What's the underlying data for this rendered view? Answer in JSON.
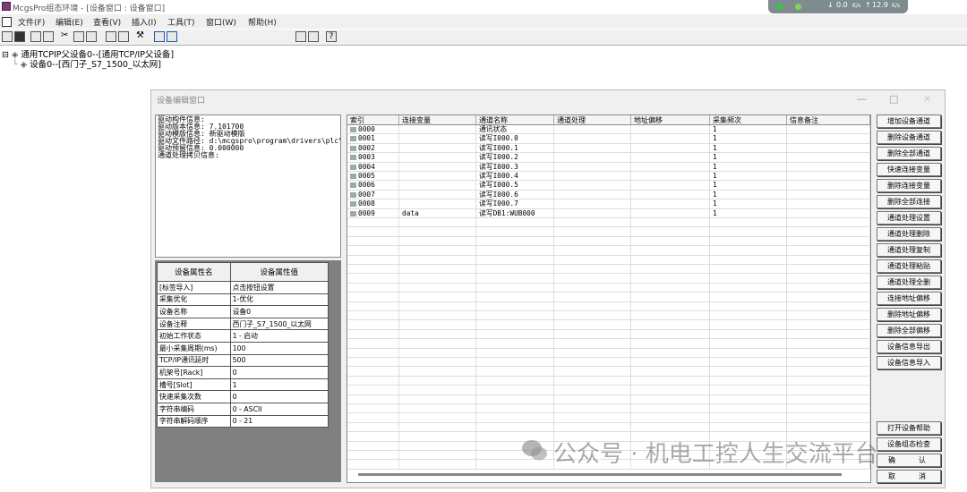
{
  "window": {
    "title": "McgsPro组态环境 - [设备窗口 : 设备窗口]"
  },
  "netwidget": {
    "down": "0.0",
    "down_unit": "K/s",
    "up": "12.9",
    "up_unit": "K/s"
  },
  "menu": [
    "文件(F)",
    "编辑(E)",
    "查看(V)",
    "插入(I)",
    "工具(T)",
    "窗口(W)",
    "帮助(H)"
  ],
  "tree": {
    "parent": "通用TCPIP父设备0--[通用TCP/IP父设备]",
    "child": "设备0--[西门子_S7_1500_以太网]"
  },
  "dialog": {
    "title": "设备编辑窗口",
    "info_lines": [
      "驱动构件信息:",
      "驱动版本信息: 7.101700",
      "驱动模版信息: 新驱动模版",
      "驱动文件路径: d:\\mcgspro\\program\\drivers\\plc\\西",
      "驱动预留信息: 0.000000",
      "通道处理拷贝信息:"
    ],
    "prop_headers": [
      "设备属性名",
      "设备属性值"
    ],
    "props": [
      [
        "[标签导入]",
        "点击按钮设置"
      ],
      [
        "采集优化",
        "1-优化"
      ],
      [
        "设备名称",
        "设备0"
      ],
      [
        "设备注释",
        "西门子_S7_1500_以太网"
      ],
      [
        "初始工作状态",
        "1 - 启动"
      ],
      [
        "最小采集周期(ms)",
        "100"
      ],
      [
        "TCP/IP通讯延时",
        "500"
      ],
      [
        "机架号[Rack]",
        "0"
      ],
      [
        "槽号[Slot]",
        "1"
      ],
      [
        "快速采集次数",
        "0"
      ],
      [
        "字符串编码",
        "0 - ASCII"
      ],
      [
        "字符串解码顺序",
        "0 - 21"
      ]
    ],
    "grid_headers": [
      "索引",
      "连接变量",
      "通道名称",
      "通道处理",
      "地址偏移",
      "采集频次",
      "信息备注"
    ],
    "grid_rows": [
      [
        "0000",
        "",
        "通讯状态",
        "",
        "",
        "1",
        ""
      ],
      [
        "0001",
        "",
        "读写I000.0",
        "",
        "",
        "1",
        ""
      ],
      [
        "0002",
        "",
        "读写I000.1",
        "",
        "",
        "1",
        ""
      ],
      [
        "0003",
        "",
        "读写I000.2",
        "",
        "",
        "1",
        ""
      ],
      [
        "0004",
        "",
        "读写I000.3",
        "",
        "",
        "1",
        ""
      ],
      [
        "0005",
        "",
        "读写I000.4",
        "",
        "",
        "1",
        ""
      ],
      [
        "0006",
        "",
        "读写I000.5",
        "",
        "",
        "1",
        ""
      ],
      [
        "0007",
        "",
        "读写I000.6",
        "",
        "",
        "1",
        ""
      ],
      [
        "0008",
        "",
        "读写I000.7",
        "",
        "",
        "1",
        ""
      ],
      [
        "0009",
        "data",
        "读写DB1:WUB000",
        "",
        "",
        "1",
        ""
      ]
    ],
    "buttons": [
      "增加设备通道",
      "删除设备通道",
      "删除全部通道",
      "快速连接变量",
      "删除连接变量",
      "删除全部连接",
      "通道处理设置",
      "通道处理删除",
      "通道处理复制",
      "通道处理粘贴",
      "通道处理全删",
      "连接地址偏移",
      "删除地址偏移",
      "删除全部偏移",
      "设备信息导出",
      "设备信息导入"
    ],
    "bottom_buttons": [
      "打开设备帮助",
      "设备组态检查",
      "确",
      "认",
      "取",
      "消"
    ]
  },
  "watermark": "公众号 · 机电工控人生交流平台"
}
